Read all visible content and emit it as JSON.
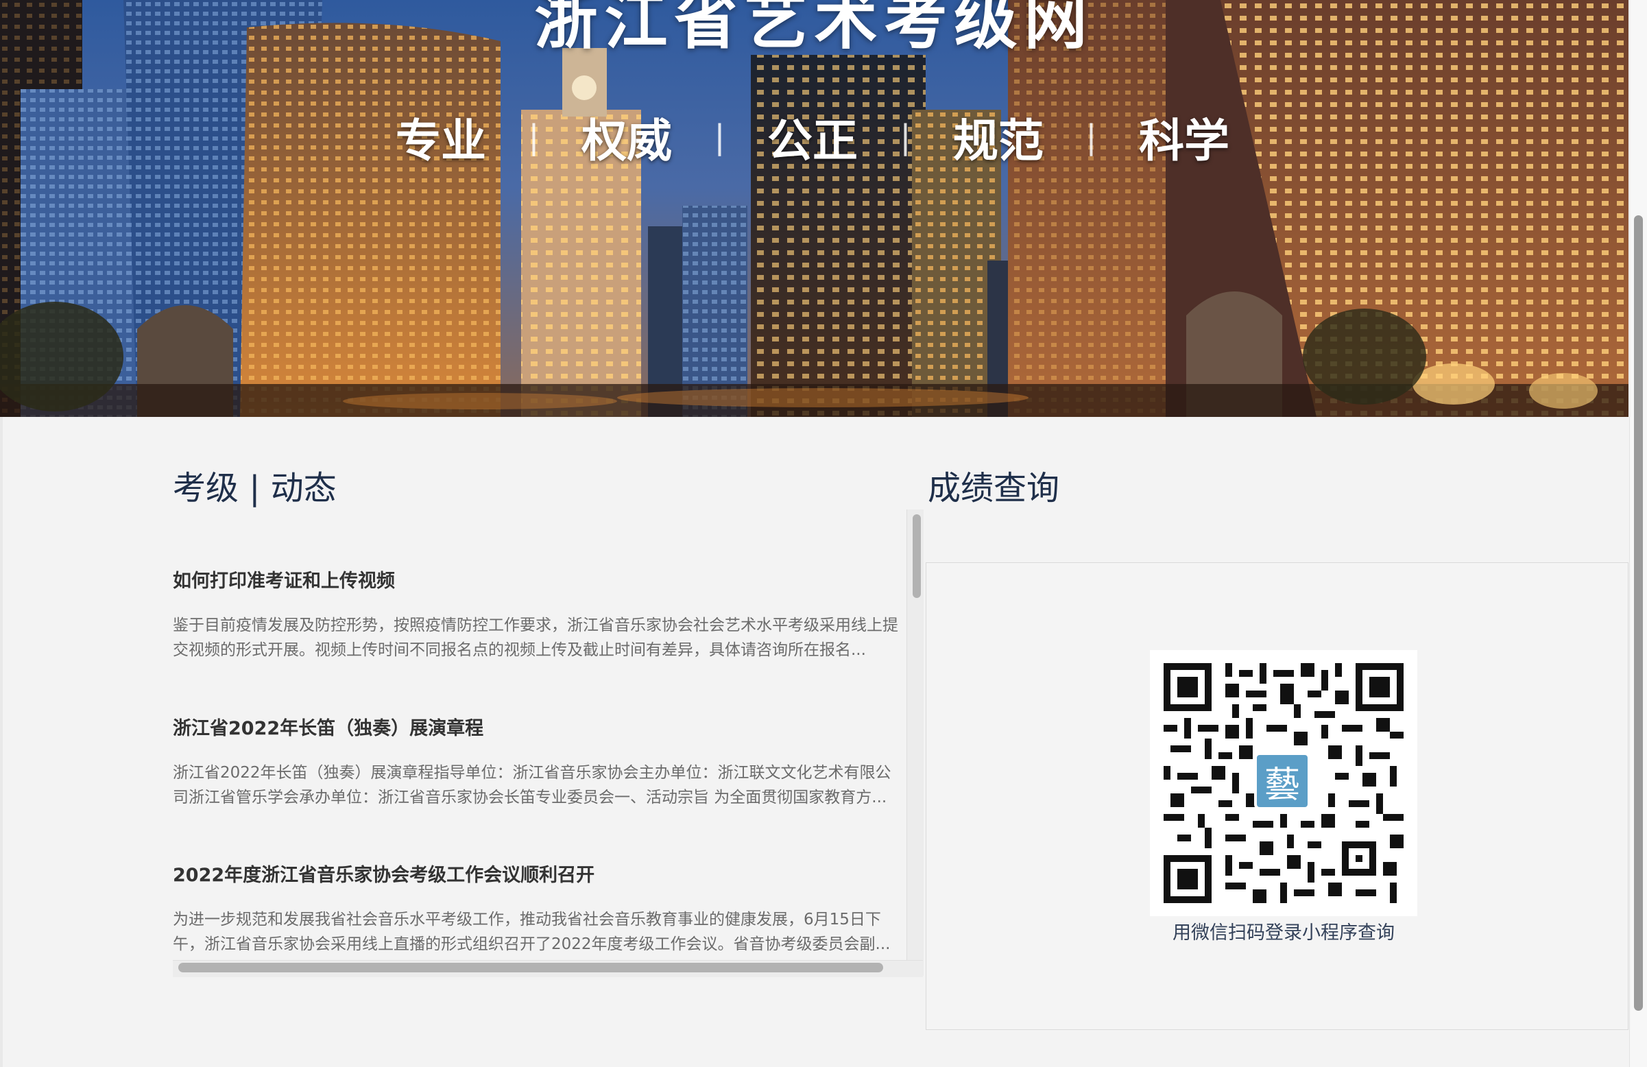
{
  "banner": {
    "title": "浙江省艺术考级网",
    "slogans": [
      "专业",
      "权威",
      "公正",
      "规范",
      "科学"
    ],
    "separator": "|"
  },
  "news": {
    "heading": "考级 | 动态",
    "items": [
      {
        "title": "如何打印准考证和上传视频",
        "summary": "鉴于目前疫情发展及防控形势，按照疫情防控工作要求，浙江省音乐家协会社会艺术水平考级采用线上提交视频的形式开展。视频上传时间不同报名点的视频上传及截止时间有差异，具体请咨询所在报名..."
      },
      {
        "title": "浙江省2022年长笛（独奏）展演章程",
        "summary": "浙江省2022年长笛（独奏）展演章程指导单位：浙江省音乐家协会主办单位：浙江联文文化艺术有限公司浙江省管乐学会承办单位：浙江省音乐家协会长笛专业委员会一、活动宗旨 为全面贯彻国家教育方..."
      },
      {
        "title": "2022年度浙江省音乐家协会考级工作会议顺利召开",
        "summary": "为进一步规范和发展我省社会音乐水平考级工作，推动我省社会音乐教育事业的健康发展，6月15日下午，浙江省音乐家协会采用线上直播的形式组织召开了2022年度考级工作会议。省音协考级委员会副..."
      }
    ]
  },
  "score": {
    "heading": "成绩查询",
    "qr_caption": "用微信扫码登录小程序查询",
    "logo_char": "藝"
  },
  "colors": {
    "page_bg": "#f3f3f3",
    "heading": "#1f2f4a",
    "logo_badge": "#5b9ec7"
  }
}
